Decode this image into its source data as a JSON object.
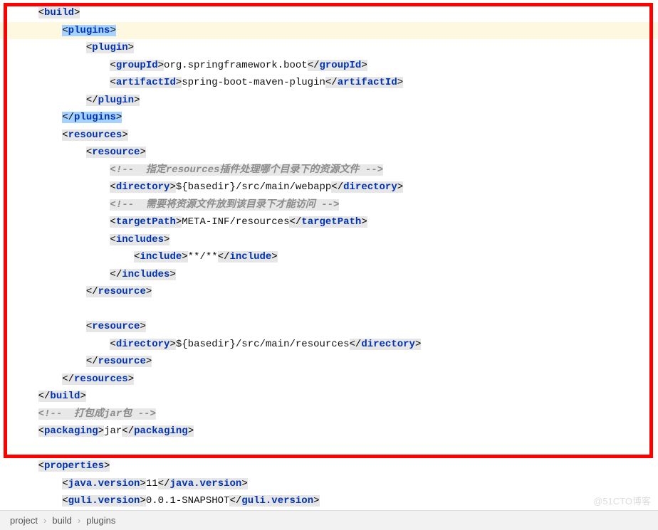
{
  "code": {
    "build": "build",
    "plugins": "plugins",
    "plugin": "plugin",
    "groupId": "groupId",
    "groupId_val": "org.springframework.boot",
    "artifactId": "artifactId",
    "artifactId_val": "spring-boot-maven-plugin",
    "resources": "resources",
    "resource": "resource",
    "cmt1_open": "<!--  ",
    "cmt1_txt": "指定resources插件处理哪个目录下的资源文件",
    "cmt1_close": " -->",
    "directory": "directory",
    "directory_val1": "${basedir}/src/main/webapp",
    "cmt2_txt": "需要将资源文件放到该目录下才能访问",
    "targetPath": "targetPath",
    "targetPath_val": "META-INF/resources",
    "includes": "includes",
    "include": "include",
    "include_val": "**/**",
    "directory_val2": "${basedir}/src/main/resources",
    "cmt3_txt": "打包成jar包",
    "packaging": "packaging",
    "packaging_val": "jar",
    "properties": "properties",
    "javaVersion": "java.version",
    "javaVersion_val": "11",
    "guliVersion": "guli.version",
    "guliVersion_val": "0.0.1-SNAPSHOT"
  },
  "breadcrumb": {
    "b1": "project",
    "b2": "build",
    "b3": "plugins"
  },
  "watermark": "@51CTO博客"
}
